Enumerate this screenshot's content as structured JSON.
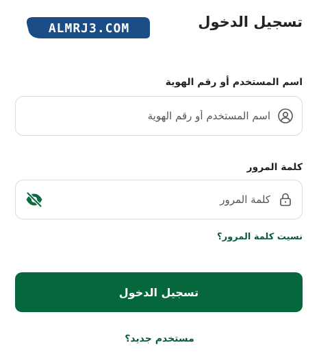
{
  "header": {
    "title": "تسجيل الدخول",
    "logo_text": "ALMRJ3.COM"
  },
  "form": {
    "username": {
      "label": "اسم المستخدم أو رقم الهوية",
      "placeholder": "اسم المستخدم أو رقم الهوية",
      "value": "",
      "icon": "user-circle-icon"
    },
    "password": {
      "label": "كلمة المرور",
      "placeholder": "كلمة المرور",
      "value": "",
      "icon": "lock-icon",
      "toggle_icon": "eye-off-icon"
    },
    "forgot_password": "نسيت كلمة المرور؟",
    "submit_label": "تسجيل الدخول",
    "new_user": "مستخدم جديد؟"
  },
  "colors": {
    "primary": "#06663c",
    "link": "#0a5c3a",
    "logo_bg": "#1a4d86"
  }
}
